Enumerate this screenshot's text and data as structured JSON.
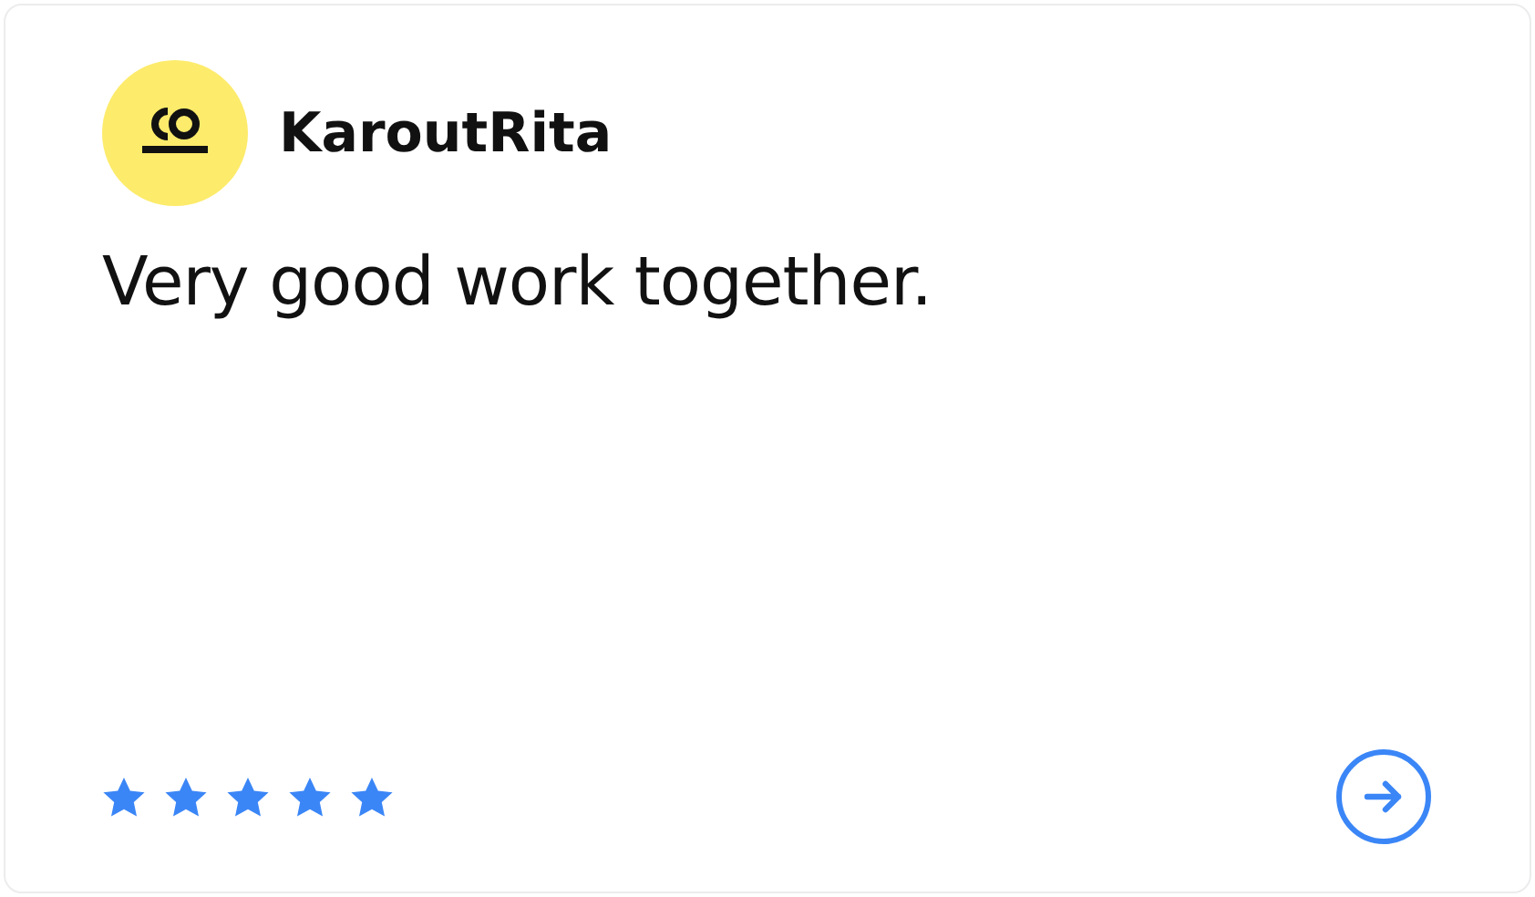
{
  "review": {
    "author": "KaroutRita",
    "text": "Very good work together.",
    "stars": 5
  }
}
